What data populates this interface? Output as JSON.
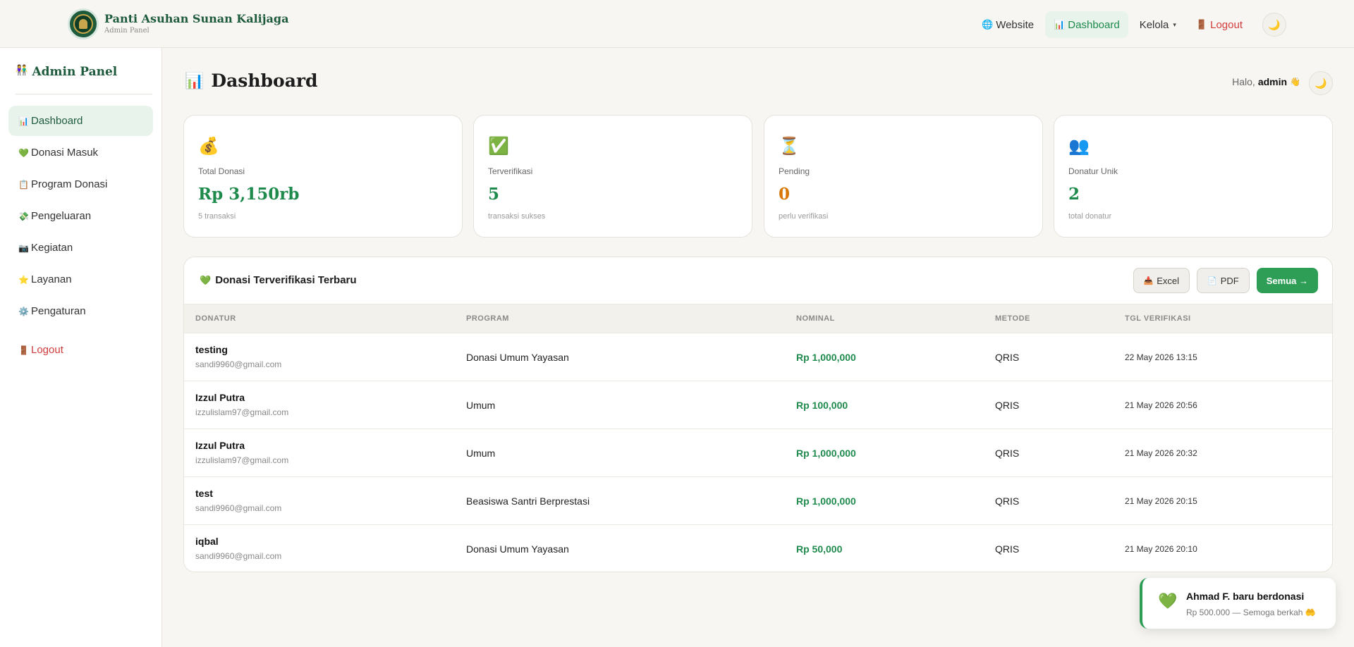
{
  "brand": {
    "title": "Panti Asuhan Sunan Kalijaga",
    "subtitle": "Admin Panel"
  },
  "topnav": {
    "website": {
      "icon": "🌐",
      "label": "Website"
    },
    "dashboard": {
      "icon": "📊",
      "label": "Dashboard"
    },
    "kelola": {
      "label": "Kelola",
      "caret": "▾"
    },
    "logout": {
      "icon": "🚪",
      "label": "Logout"
    },
    "theme_icon": "🌙"
  },
  "sidebar": {
    "title_icon": "👫",
    "title": "Admin Panel",
    "items": [
      {
        "icon": "📊",
        "label": "Dashboard"
      },
      {
        "icon": "💚",
        "label": "Donasi Masuk"
      },
      {
        "icon": "📋",
        "label": "Program Donasi"
      },
      {
        "icon": "💸",
        "label": "Pengeluaran"
      },
      {
        "icon": "📷",
        "label": "Kegiatan"
      },
      {
        "icon": "⭐",
        "label": "Layanan"
      },
      {
        "icon": "⚙️",
        "label": "Pengaturan"
      }
    ],
    "logout": {
      "icon": "🚪",
      "label": "Logout"
    }
  },
  "header": {
    "title_icon": "📊",
    "title": "Dashboard",
    "greeting_prefix": "Halo,",
    "user": "admin",
    "wave": "👋",
    "theme_icon": "🌙"
  },
  "stats": [
    {
      "icon": "💰",
      "label": "Total Donasi",
      "value": "Rp 3,150rb",
      "sub": "5 transaksi",
      "color": "#1e8a4c"
    },
    {
      "icon": "✅",
      "label": "Terverifikasi",
      "value": "5",
      "sub": "transaksi sukses",
      "color": "#1e8a4c"
    },
    {
      "icon": "⏳",
      "label": "Pending",
      "value": "0",
      "sub": "perlu verifikasi",
      "color": "#d97706"
    },
    {
      "icon": "👥",
      "label": "Donatur Unik",
      "value": "2",
      "sub": "total donatur",
      "color": "#1e8a4c"
    }
  ],
  "panel": {
    "icon": "💚",
    "title": "Donasi Terverifikasi Terbaru",
    "buttons": {
      "excel": {
        "icon": "📥",
        "label": "Excel"
      },
      "pdf": {
        "icon": "📄",
        "label": "PDF"
      },
      "all": {
        "label": "Semua →"
      }
    },
    "columns": [
      "DONATUR",
      "PROGRAM",
      "NOMINAL",
      "METODE",
      "TGL VERIFIKASI"
    ],
    "rows": [
      {
        "name": "testing",
        "email": "sandi9960@gmail.com",
        "program": "Donasi Umum Yayasan",
        "nominal": "Rp 1,000,000",
        "metode": "QRIS",
        "tgl": "22 May 2026 13:15"
      },
      {
        "name": "Izzul Putra",
        "email": "izzulislam97@gmail.com",
        "program": "Umum",
        "nominal": "Rp 100,000",
        "metode": "QRIS",
        "tgl": "21 May 2026 20:56"
      },
      {
        "name": "Izzul Putra",
        "email": "izzulislam97@gmail.com",
        "program": "Umum",
        "nominal": "Rp 1,000,000",
        "metode": "QRIS",
        "tgl": "21 May 2026 20:32"
      },
      {
        "name": "test",
        "email": "sandi9960@gmail.com",
        "program": "Beasiswa Santri Berprestasi",
        "nominal": "Rp 1,000,000",
        "metode": "QRIS",
        "tgl": "21 May 2026 20:15"
      },
      {
        "name": "iqbal",
        "email": "sandi9960@gmail.com",
        "program": "Donasi Umum Yayasan",
        "nominal": "Rp 50,000",
        "metode": "QRIS",
        "tgl": "21 May 2026 20:10"
      }
    ]
  },
  "toast": {
    "icon": "💚",
    "title": "Ahmad F. baru berdonasi",
    "message": "Rp 500.000 — Semoga berkah 🤲"
  }
}
